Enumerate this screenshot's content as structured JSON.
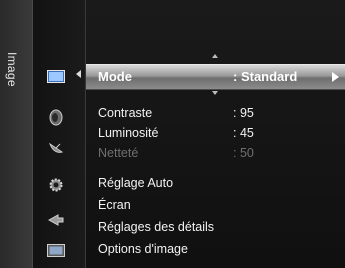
{
  "side_tab": {
    "label": "Image"
  },
  "icons": [
    {
      "name": "picture-icon",
      "active": true
    },
    {
      "name": "sound-icon"
    },
    {
      "name": "satellite-channel-icon"
    },
    {
      "name": "setup-gear-icon"
    },
    {
      "name": "input-icon"
    },
    {
      "name": "application-icon"
    }
  ],
  "menu": {
    "items": [
      {
        "label": "Mode",
        "value": ": Standard",
        "selected": true
      },
      {
        "label": "Contraste",
        "value": ": 95"
      },
      {
        "label": "Luminosité",
        "value": ": 45"
      },
      {
        "label": "Netteté",
        "value": ": 50",
        "disabled": true
      },
      {
        "label": "Réglage Auto",
        "value": ""
      },
      {
        "label": "Écran",
        "value": ""
      },
      {
        "label": "Réglages des détails",
        "value": ""
      },
      {
        "label": "Options d'image",
        "value": ""
      }
    ]
  },
  "colors": {
    "background": "#101010",
    "highlight": "#9a9a9a",
    "text": "#f2f2f2",
    "disabled_text": "#6f6f6f"
  }
}
